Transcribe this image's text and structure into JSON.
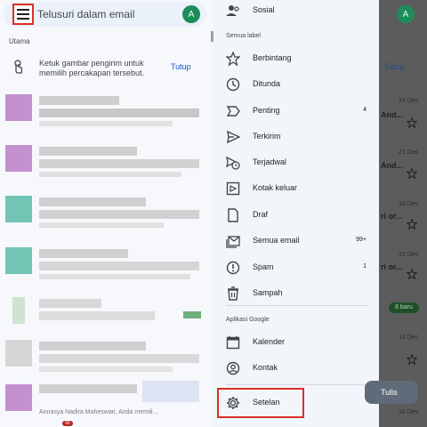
{
  "left": {
    "search_placeholder": "Telusuri dalam email",
    "avatar_letter": "A",
    "section_label": "Utama",
    "info_text": "Ketuk gambar pengirim untuk memilih percakapan tersebut.",
    "info_close": "Tutup",
    "row_snippet": "Annasya Nadira Maheswari, Anda memili...",
    "nav_badge": "66"
  },
  "drawer": {
    "top_item": {
      "label": "Sosial",
      "icon": "people-icon"
    },
    "section_all": "Semua label",
    "items": [
      {
        "label": "Berbintang",
        "icon": "star-icon",
        "count": ""
      },
      {
        "label": "Ditunda",
        "icon": "clock-icon",
        "count": ""
      },
      {
        "label": "Penting",
        "icon": "important-icon",
        "count": "4"
      },
      {
        "label": "Terkirim",
        "icon": "send-icon",
        "count": ""
      },
      {
        "label": "Terjadwal",
        "icon": "scheduled-icon",
        "count": ""
      },
      {
        "label": "Kotak keluar",
        "icon": "outbox-icon",
        "count": ""
      },
      {
        "label": "Draf",
        "icon": "draft-icon",
        "count": ""
      },
      {
        "label": "Semua email",
        "icon": "all-mail-icon",
        "count": "99+"
      },
      {
        "label": "Spam",
        "icon": "spam-icon",
        "count": "1"
      },
      {
        "label": "Sampah",
        "icon": "trash-icon",
        "count": ""
      }
    ],
    "section_apps": "Aplikasi Google",
    "apps": [
      {
        "label": "Kalender",
        "icon": "calendar-icon"
      },
      {
        "label": "Kontak",
        "icon": "contacts-icon"
      }
    ],
    "settings": {
      "label": "Setelan",
      "icon": "gear-icon"
    }
  },
  "right": {
    "avatar_letter": "A",
    "tutup": "Tutup",
    "dates": [
      "24 Des",
      "21 Des",
      "18 Des",
      "15 Des",
      "16 Des",
      "16 Des"
    ],
    "snippets": [
      "And...",
      "And...",
      "ri or...",
      "ri or..."
    ],
    "new_badge": "6 baru",
    "compose": "Tulis"
  },
  "colors": {
    "accent": "#0b57d0",
    "highlight": "#d93025",
    "avatar": "#1b8e5a"
  }
}
